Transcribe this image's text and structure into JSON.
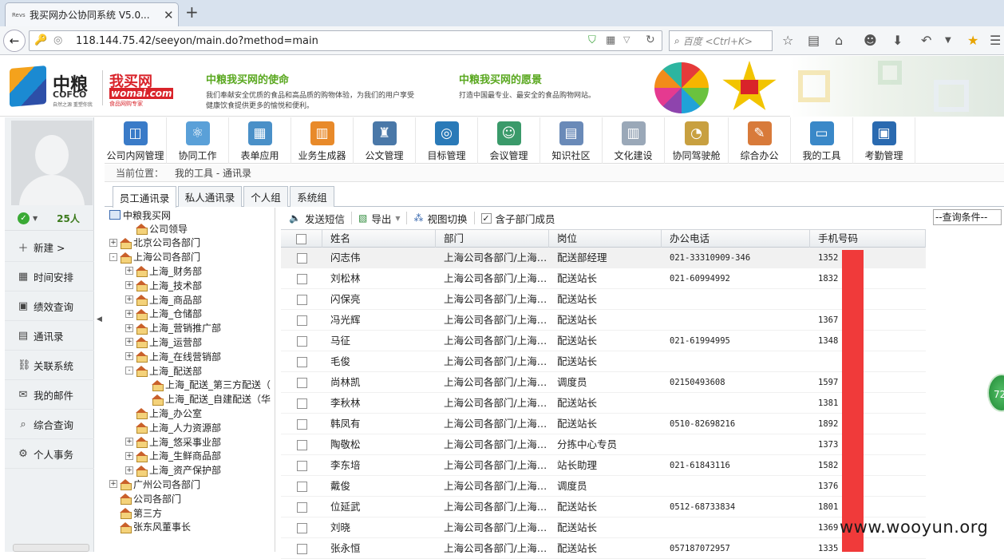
{
  "browser": {
    "tab_title": "我买网办公协同系统 V5.0...",
    "favicon_text": "Revs",
    "new_tab": "+",
    "url": "118.144.75.42/seeyon/main.do?method=main",
    "search_placeholder": "百度 <Ctrl+K>"
  },
  "banner": {
    "logo_cn": "中粮",
    "logo_en": "COFCO",
    "logo_sub": "自然之源 重塑你我",
    "logo2": "我买网",
    "logo2_en": "womai.com",
    "logo2_tag": "食品网购专家",
    "mission_title": "中粮我买网的使命",
    "mission_text_1": "我们奉献安全优质的食品和高品质的购物体验，为我们的用户享受",
    "mission_text_2": "健康饮食提供更多的愉悦和便利。",
    "vision_title": "中粮我买网的愿景",
    "vision_text": "打造中国最专业、最安全的食品购物网站。"
  },
  "left": {
    "online_count": "25人",
    "menu": [
      {
        "label": "新建 >",
        "icon": "plus-icon"
      },
      {
        "label": "时间安排",
        "icon": "calendar-icon"
      },
      {
        "label": "绩效查询",
        "icon": "chart-icon"
      },
      {
        "label": "通讯录",
        "icon": "addressbook-icon"
      },
      {
        "label": "关联系统",
        "icon": "link-icon"
      },
      {
        "label": "我的邮件",
        "icon": "mail-icon"
      },
      {
        "label": "综合查询",
        "icon": "search-icon"
      },
      {
        "label": "个人事务",
        "icon": "gear-icon"
      }
    ]
  },
  "modules": [
    {
      "label": "公司内网管理",
      "color": "#3a7bc8"
    },
    {
      "label": "协同工作",
      "color": "#5aa0d8"
    },
    {
      "label": "表单应用",
      "color": "#4a90c8"
    },
    {
      "label": "业务生成器",
      "color": "#e88a2a"
    },
    {
      "label": "公文管理",
      "color": "#4a78a8"
    },
    {
      "label": "目标管理",
      "color": "#2a7ab8"
    },
    {
      "label": "会议管理",
      "color": "#3a9a6a"
    },
    {
      "label": "知识社区",
      "color": "#6a8ab8"
    },
    {
      "label": "文化建设",
      "color": "#9aa8b8"
    },
    {
      "label": "协同驾驶舱",
      "color": "#c8a040"
    },
    {
      "label": "综合办公",
      "color": "#d87a3a"
    },
    {
      "label": "我的工具",
      "color": "#3a88c8"
    },
    {
      "label": "考勤管理",
      "color": "#2a6ab0"
    }
  ],
  "breadcrumb": {
    "label": "当前位置：",
    "path": "我的工具 - 通讯录"
  },
  "tabs": [
    "员工通讯录",
    "私人通讯录",
    "个人组",
    "系统组"
  ],
  "tree": {
    "root": "中粮我买网",
    "nodes": [
      "公司领导",
      "北京公司各部门",
      "上海公司各部门",
      "上海_财务部",
      "上海_技术部",
      "上海_商品部",
      "上海_仓储部",
      "上海_营销推广部",
      "上海_运营部",
      "上海_在线营销部",
      "上海_配送部",
      "上海_配送_第三方配送（",
      "上海_配送_自建配送（华",
      "上海_办公室",
      "上海_人力资源部",
      "上海_悠采事业部",
      "上海_生鲜商品部",
      "上海_资产保护部",
      "广州公司各部门",
      "公司各部门",
      "第三方",
      "张东风董事长"
    ]
  },
  "toolbar": {
    "send_msg": "发送短信",
    "export": "导出",
    "view_switch": "视图切换",
    "include_sub": "含子部门成员",
    "query": "--查询条件--"
  },
  "grid": {
    "headers": [
      "姓名",
      "部门",
      "岗位",
      "办公电话",
      "手机号码"
    ],
    "rows": [
      {
        "name": "闪志伟",
        "dept": "上海公司各部门/上海…",
        "post": "配送部经理",
        "tel": "021-33310909-346",
        "mobile": "1352    99"
      },
      {
        "name": "刘松林",
        "dept": "上海公司各部门/上海…",
        "post": "配送站长",
        "tel": "021-60994992",
        "mobile": "1832    48"
      },
      {
        "name": "闪保亮",
        "dept": "上海公司各部门/上海…",
        "post": "配送站长",
        "tel": "",
        "mobile": ""
      },
      {
        "name": "冯光辉",
        "dept": "上海公司各部门/上海…",
        "post": "配送站长",
        "tel": "",
        "mobile": "1367    730"
      },
      {
        "name": "马征",
        "dept": "上海公司各部门/上海…",
        "post": "配送站长",
        "tel": "021-61994995",
        "mobile": "1348    375"
      },
      {
        "name": "毛俊",
        "dept": "上海公司各部门/上海…",
        "post": "配送站长",
        "tel": "",
        "mobile": ""
      },
      {
        "name": "尚林凯",
        "dept": "上海公司各部门/上海…",
        "post": "调度员",
        "tel": "02150493608",
        "mobile": "1597    363"
      },
      {
        "name": "李秋林",
        "dept": "上海公司各部门/上海…",
        "post": "配送站长",
        "tel": "",
        "mobile": "1381    362"
      },
      {
        "name": "韩凤有",
        "dept": "上海公司各部门/上海…",
        "post": "配送站长",
        "tel": "0510-82698216",
        "mobile": "1892    376"
      },
      {
        "name": "陶敬松",
        "dept": "上海公司各部门/上海…",
        "post": "分拣中心专员",
        "tel": "",
        "mobile": "1373    370"
      },
      {
        "name": "李东培",
        "dept": "上海公司各部门/上海…",
        "post": "站长助理",
        "tel": "021-61843116",
        "mobile": "1582    606"
      },
      {
        "name": "戴俊",
        "dept": "上海公司各部门/上海…",
        "post": "调度员",
        "tel": "",
        "mobile": "1376    349"
      },
      {
        "name": "位延武",
        "dept": "上海公司各部门/上海…",
        "post": "配送站长",
        "tel": "0512-68733834",
        "mobile": "1801    359"
      },
      {
        "name": "刘晓",
        "dept": "上海公司各部门/上海…",
        "post": "配送站长",
        "tel": "",
        "mobile": "1369"
      },
      {
        "name": "张永恒",
        "dept": "上海公司各部门/上海…",
        "post": "配送站长",
        "tel": "057187072957",
        "mobile": "1335  780"
      }
    ]
  },
  "float_badge": "72",
  "watermark": "www.wooyun.org"
}
